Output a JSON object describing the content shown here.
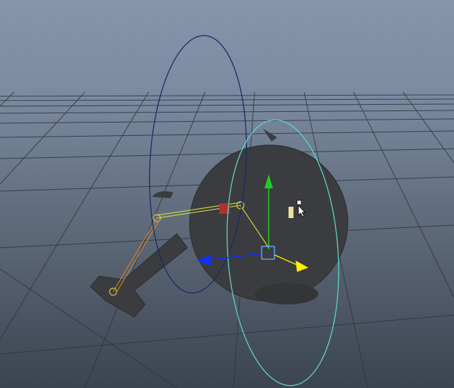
{
  "viewport": {
    "type": "3d-perspective-viewport",
    "colors": {
      "background_top": "#8595ab",
      "background_bottom": "#3b4450",
      "grid": "#2e343c",
      "mesh": "#3a3c3f",
      "rotate_x_ring": "#1a2a66",
      "rotate_y_ring": "#5fd6c0",
      "axis_y": "#22cc22",
      "axis_x": "#1030ff",
      "axis_z": "#ffee00",
      "joint": "#c8d040",
      "selected_control": "#b03030"
    },
    "icons": [
      "mouse-cursor-icon",
      "move-manipulator-icon",
      "rotate-manipulator-icon"
    ]
  }
}
